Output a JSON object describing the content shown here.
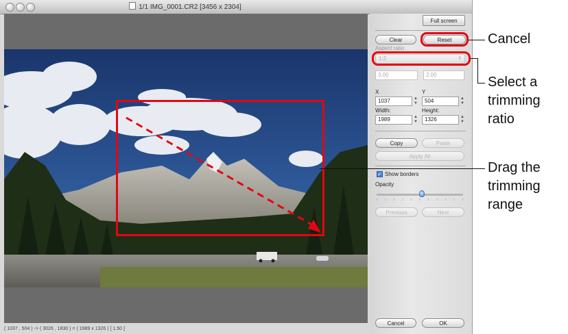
{
  "window": {
    "title": "1/1 IMG_0001.CR2 [3456 x 2304]",
    "status": "( 1037 , 504 ) -> ( 3026 , 1830 ) = ( 1989 x 1326 ) [ 1.50 ]"
  },
  "panel": {
    "full_screen": "Full screen",
    "clear": "Clear",
    "reset": "Reset",
    "aspect_ratio_label": "Aspect ratio",
    "aspect_ratio_value": "1:2",
    "ratio_a": "3.00",
    "ratio_b": "2.00",
    "x_label": "X",
    "y_label": "Y",
    "x_value": "1037",
    "y_value": "504",
    "width_label": "Width:",
    "height_label": "Height:",
    "width_value": "1989",
    "height_value": "1326",
    "copy": "Copy",
    "paste": "Paste",
    "apply_all": "Apply All",
    "show_borders": "Show borders",
    "opacity_label": "Opacity",
    "opacity_level": 0.52,
    "previous": "Previous",
    "next": "Next",
    "cancel": "Cancel",
    "ok": "OK"
  },
  "callouts": {
    "cancel": "Cancel",
    "ratio_line1": "Select a",
    "ratio_line2": "trimming",
    "ratio_line3": "ratio",
    "drag_line1": "Drag the",
    "drag_line2": "trimming",
    "drag_line3": "range"
  },
  "colors": {
    "highlight": "#e30613",
    "sky": "#23457f",
    "forest": "#1f2e17"
  }
}
